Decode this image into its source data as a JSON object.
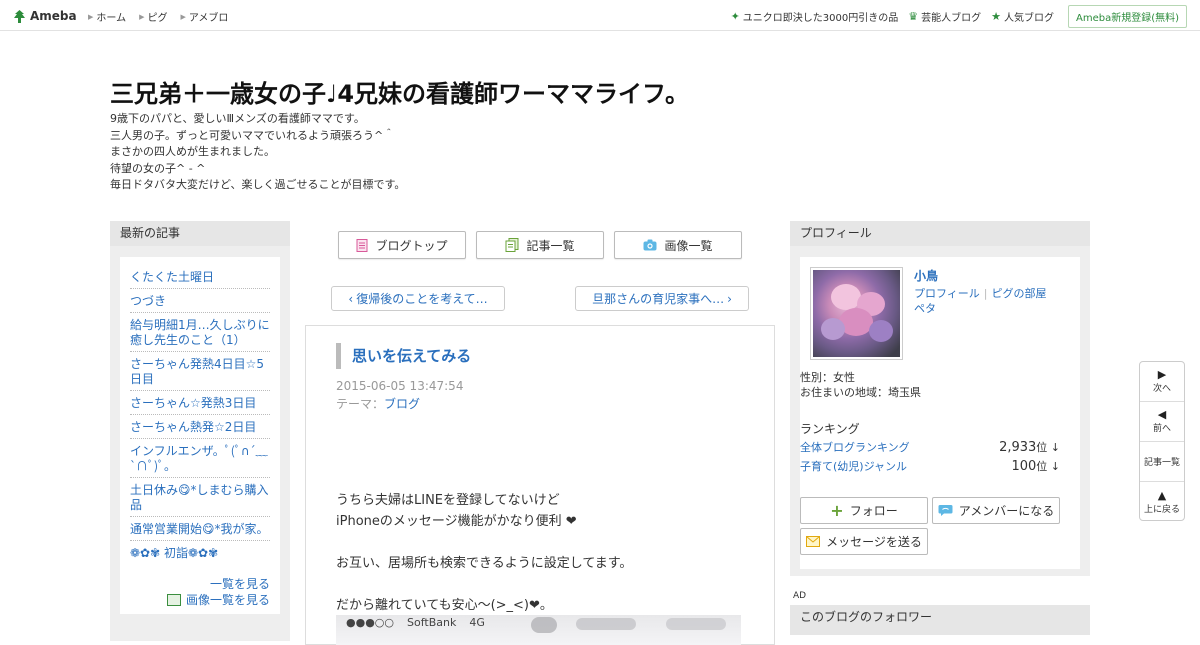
{
  "topbar": {
    "logo_text": "Ameba",
    "nav": [
      "ホーム",
      "ピグ",
      "アメブロ"
    ],
    "right_links": [
      {
        "icon": "sparkle-icon",
        "label": "ユニクロ即決した3000円引きの品"
      },
      {
        "icon": "crown-icon",
        "label": "芸能人ブログ"
      },
      {
        "icon": "star-icon",
        "label": "人気ブログ"
      }
    ],
    "register_label": "Ameba新規登録(無料)"
  },
  "blog": {
    "title": "三兄弟＋一歳女の子♩4兄妹の看護師ワーママライフ。",
    "description": [
      "9歳下のパパと、愛しいⅢメンズの看護師ママです。",
      "三人男の子。ずっと可愛いママでいれるよう頑張ろう^＾",
      "まさかの四人めが生まれました。",
      "待望の女の子^ - ^",
      "毎日ドタバタ大変だけど、楽しく過ごせることが目標です。"
    ]
  },
  "sidebar": {
    "heading": "最新の記事",
    "articles": [
      "くたくた土曜日",
      "つづき",
      "給与明細1月…久しぶりに癒し先生のこと（1）",
      "さーちゃん発熱4日目☆5日目",
      "さーちゃん☆発熱3日目",
      "さーちゃん熱発☆2日目",
      "インフルエンザ。ﾟ(ﾟ∩´﹏`∩ﾟ)ﾟ。",
      "土日休み😋*しまむら購入品",
      "通常営業開始😋*我が家。",
      "❁✿✾ 初詣❁✿✾"
    ],
    "more_label": "一覧を見る",
    "images_label": "画像一覧を見る"
  },
  "toolbar": {
    "blog_top": "ブログトップ",
    "article_list": "記事一覧",
    "image_list": "画像一覧"
  },
  "pager": {
    "prev": "復帰後のことを考えて…",
    "next": "旦那さんの育児家事へ…"
  },
  "article": {
    "title": "思いを伝えてみる",
    "date": "2015-06-05 13:47:54",
    "theme_label": "テーマ：",
    "theme": "ブログ",
    "body": [
      "うちら夫婦はLINEを登録してないけど",
      "iPhoneのメッセージ機能がかなり便利 ❤",
      "",
      "お互い、居場所も検索できるように設定してます。",
      "",
      "だから離れていても安心～(>_<)❤。"
    ],
    "screenshot_status": {
      "signal": "●●●○○",
      "carrier": "SoftBank",
      "network": "4G"
    }
  },
  "profile": {
    "heading": "プロフィール",
    "name": "小鳥",
    "link_profile": "プロフィール",
    "link_pig_room": "ピグの部屋",
    "link_peta": "ペタ",
    "gender": "性別：女性",
    "region": "お住まいの地域：埼玉県",
    "ranking_label": "ランキング",
    "rankings": [
      {
        "label": "全体ブログランキング",
        "value": "2,933",
        "unit": "位",
        "trend": "↓"
      },
      {
        "label": "子育て(幼児)ジャンル",
        "value": "100",
        "unit": "位",
        "trend": "↓"
      }
    ],
    "follow_label": "フォロー",
    "amember_label": "アメンバーになる",
    "message_label": "メッセージを送る"
  },
  "ad_label": "AD",
  "followers_heading": "このブログのフォロワー",
  "float_nav": {
    "next": "次へ",
    "prev": "前へ",
    "list": "記事一覧",
    "top": "上に戻る"
  },
  "colors": {
    "link": "#2a6fbd",
    "ameba_green": "#2d8c3c",
    "panel_bg": "#eeeeee"
  }
}
